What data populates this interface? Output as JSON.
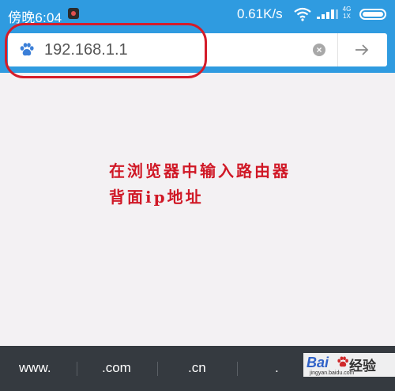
{
  "status_bar": {
    "time": "傍晚6:04",
    "net_speed": "0.61K/s",
    "network_label": [
      "4G",
      "1X"
    ],
    "icons": [
      "record-icon",
      "wifi-icon",
      "signal-icon",
      "battery-icon"
    ]
  },
  "address_bar": {
    "url": "192.168.1.1",
    "icons": [
      "baidu-paw-icon",
      "clear-icon",
      "go-arrow-icon"
    ],
    "clear_glyph": "×"
  },
  "annotation": {
    "line1": "在浏览器中输入路由器",
    "line2": "背面ip地址",
    "color": "#d01826"
  },
  "suggestions": [
    ".com",
    ".cn",
    "."
  ],
  "suggestion_first": "www.",
  "watermark": {
    "bai": "Bai",
    "jingyan": "经验",
    "url": "jingyan.baidu.com"
  },
  "colors": {
    "accent": "#2f9be0",
    "bottom_bar": "#353a40",
    "highlight": "#d41c2a"
  }
}
